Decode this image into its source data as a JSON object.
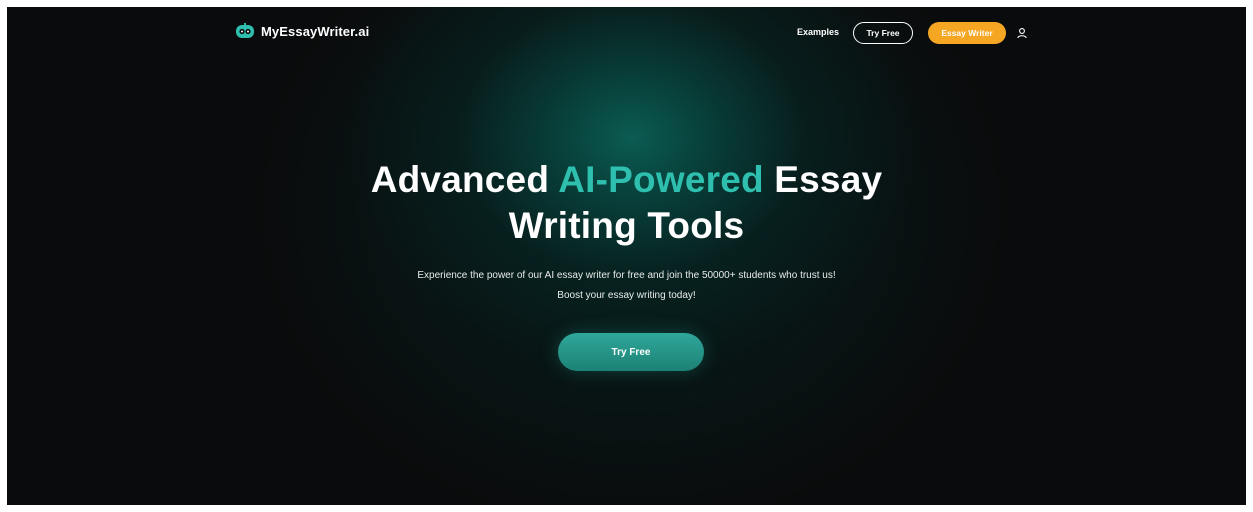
{
  "brand": {
    "name": "MyEssayWriter.ai",
    "logo_icon": "robot-face-icon",
    "accent_color": "#2ebfae"
  },
  "nav": {
    "examples_label": "Examples",
    "try_free_label": "Try Free",
    "essay_writer_label": "Essay Writer",
    "essay_writer_color": "#f5a623",
    "account_icon": "user-icon"
  },
  "hero": {
    "title_part1": "Advanced ",
    "title_accent": "AI-Powered",
    "title_part2": " Essay",
    "title_line2": "Writing Tools",
    "subtitle_line1": "Experience the power of our AI essay writer for free and join the 50000+ students who trust us!",
    "subtitle_line2": "Boost your essay writing today!",
    "cta_label": "Try Free"
  }
}
